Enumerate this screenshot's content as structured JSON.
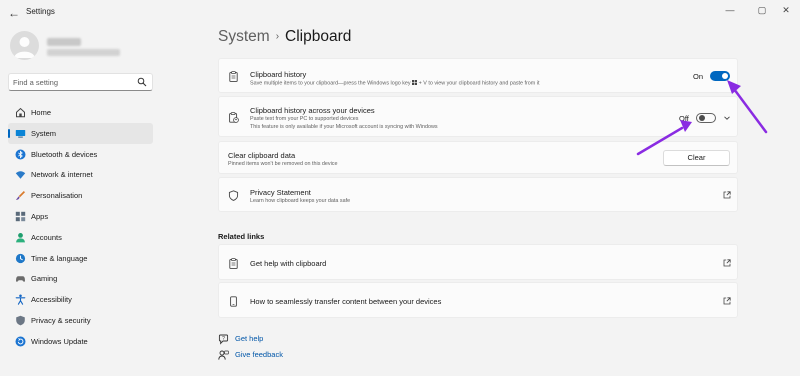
{
  "window": {
    "title": "Settings",
    "back_glyph": "←",
    "minimize_glyph": "—",
    "maximize_glyph": "▢",
    "close_glyph": "✕"
  },
  "search": {
    "placeholder": "Find a setting",
    "icon": "search-icon"
  },
  "sidebar": {
    "items": [
      {
        "label": "Home",
        "icon": "home-icon",
        "active": false
      },
      {
        "label": "System",
        "icon": "system-icon",
        "active": true
      },
      {
        "label": "Bluetooth & devices",
        "icon": "bluetooth-icon",
        "active": false
      },
      {
        "label": "Network & internet",
        "icon": "wifi-icon",
        "active": false
      },
      {
        "label": "Personalisation",
        "icon": "brush-icon",
        "active": false
      },
      {
        "label": "Apps",
        "icon": "apps-icon",
        "active": false
      },
      {
        "label": "Accounts",
        "icon": "accounts-icon",
        "active": false
      },
      {
        "label": "Time & language",
        "icon": "globe-clock-icon",
        "active": false
      },
      {
        "label": "Gaming",
        "icon": "gamepad-icon",
        "active": false
      },
      {
        "label": "Accessibility",
        "icon": "accessibility-icon",
        "active": false
      },
      {
        "label": "Privacy & security",
        "icon": "shield-icon",
        "active": false
      },
      {
        "label": "Windows Update",
        "icon": "update-icon",
        "active": false
      }
    ]
  },
  "breadcrumb": {
    "parent": "System",
    "separator": "›",
    "current": "Clipboard"
  },
  "settings": {
    "clipboard_history": {
      "title": "Clipboard history",
      "desc_before": "Save multiple items to your clipboard—press the Windows logo key",
      "desc_after": "+ V to view your clipboard history and paste from it",
      "state_label": "On",
      "enabled": true
    },
    "sync": {
      "title": "Clipboard history across your devices",
      "desc_line1": "Paste text from your PC to supported devices",
      "desc_line2": "This feature is only available if your Microsoft account is syncing with Windows",
      "state_label": "Off",
      "enabled": false
    },
    "clear": {
      "title": "Clear clipboard data",
      "desc": "Pinned items won't be removed on this device",
      "button_label": "Clear"
    },
    "privacy": {
      "title": "Privacy Statement",
      "desc": "Learn how clipboard keeps your data safe"
    }
  },
  "related": {
    "heading": "Related links",
    "links": [
      {
        "label": "Get help with clipboard",
        "icon": "clipboard-icon"
      },
      {
        "label": "How to seamlessly transfer content between your devices",
        "icon": "phone-icon"
      }
    ]
  },
  "footer": {
    "get_help": "Get help",
    "give_feedback": "Give feedback"
  },
  "colors": {
    "accent": "#0067c0",
    "annotation_arrow": "#8a2be2",
    "background": "#f3f3f3",
    "card": "#fbfbfb"
  }
}
